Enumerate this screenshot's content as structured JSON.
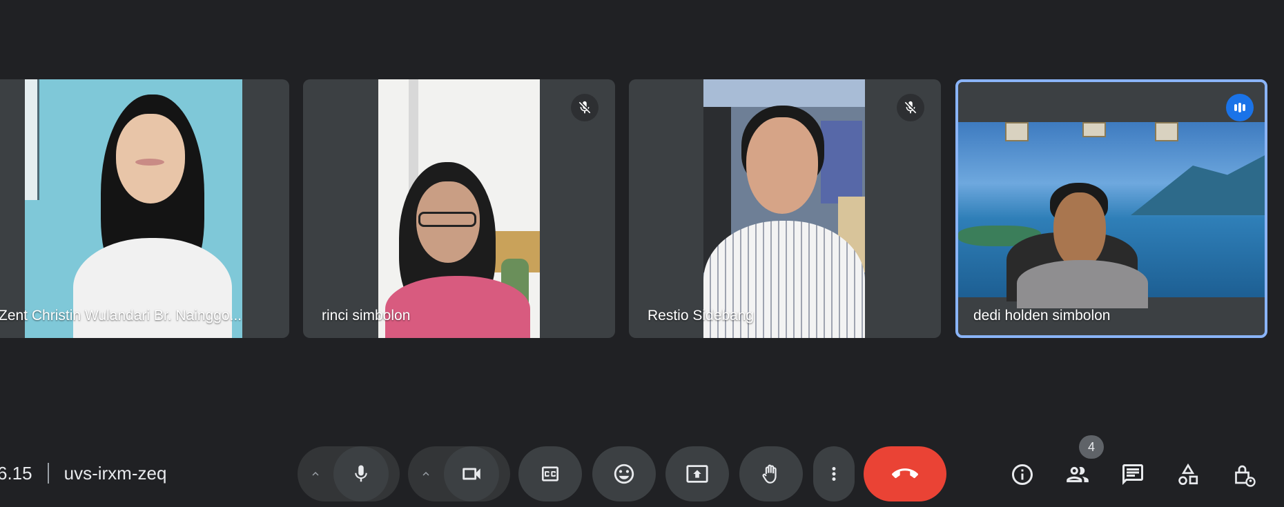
{
  "participants": [
    {
      "name": "Zent Christin Wulandari Br. Nainggo...",
      "muted": false
    },
    {
      "name": "rinci simbolon",
      "muted": true
    },
    {
      "name": "Restio Sidebang",
      "muted": true
    },
    {
      "name": "dedi holden simbolon",
      "muted": false,
      "speaking": true
    }
  ],
  "meeting": {
    "time": "6.15",
    "code": "uvs-irxm-zeq"
  },
  "people_count": "4",
  "colors": {
    "accent": "#8ab4f8",
    "end_call": "#ea4335",
    "speaking": "#1a73e8",
    "background": "#202124",
    "tile": "#3c4043"
  },
  "controls": [
    "microphone-icon",
    "camera-icon",
    "captions-icon",
    "emoji-icon",
    "present-icon",
    "raise-hand-icon",
    "more-options-icon",
    "end-call-icon"
  ],
  "side_controls": [
    "info-icon",
    "people-icon",
    "chat-icon",
    "activities-icon",
    "host-controls-icon"
  ]
}
